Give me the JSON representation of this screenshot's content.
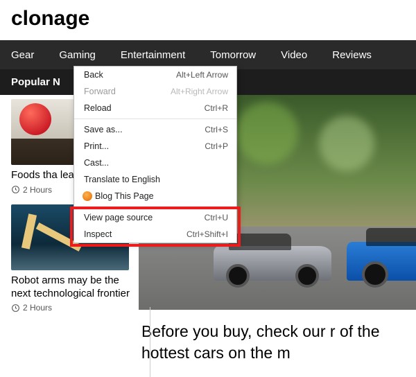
{
  "site_title": "clonage",
  "nav": [
    "Gear",
    "Gaming",
    "Entertainment",
    "Tomorrow",
    "Video",
    "Reviews"
  ],
  "section_header": "Popular N",
  "sidebar": {
    "cards": [
      {
        "title": "Foods tha learning",
        "meta": "2 Hours"
      },
      {
        "title": "Robot arms may be the next technological frontier",
        "meta": "2 Hours"
      }
    ]
  },
  "hero": {
    "caption": "Before you buy, check our r of the hottest cars on the m"
  },
  "context_menu": {
    "groups": [
      [
        {
          "label": "Back",
          "shortcut": "Alt+Left Arrow",
          "disabled": false
        },
        {
          "label": "Forward",
          "shortcut": "Alt+Right Arrow",
          "disabled": true
        },
        {
          "label": "Reload",
          "shortcut": "Ctrl+R",
          "disabled": false
        }
      ],
      [
        {
          "label": "Save as...",
          "shortcut": "Ctrl+S",
          "disabled": false
        },
        {
          "label": "Print...",
          "shortcut": "Ctrl+P",
          "disabled": false
        },
        {
          "label": "Cast...",
          "shortcut": "",
          "disabled": false
        },
        {
          "label": "Translate to English",
          "shortcut": "",
          "disabled": false
        },
        {
          "label": "Blog This Page",
          "shortcut": "",
          "disabled": false,
          "icon": "blogger-icon"
        }
      ],
      [
        {
          "label": "View page source",
          "shortcut": "Ctrl+U",
          "disabled": false
        },
        {
          "label": "Inspect",
          "shortcut": "Ctrl+Shift+I",
          "disabled": false
        }
      ]
    ]
  }
}
